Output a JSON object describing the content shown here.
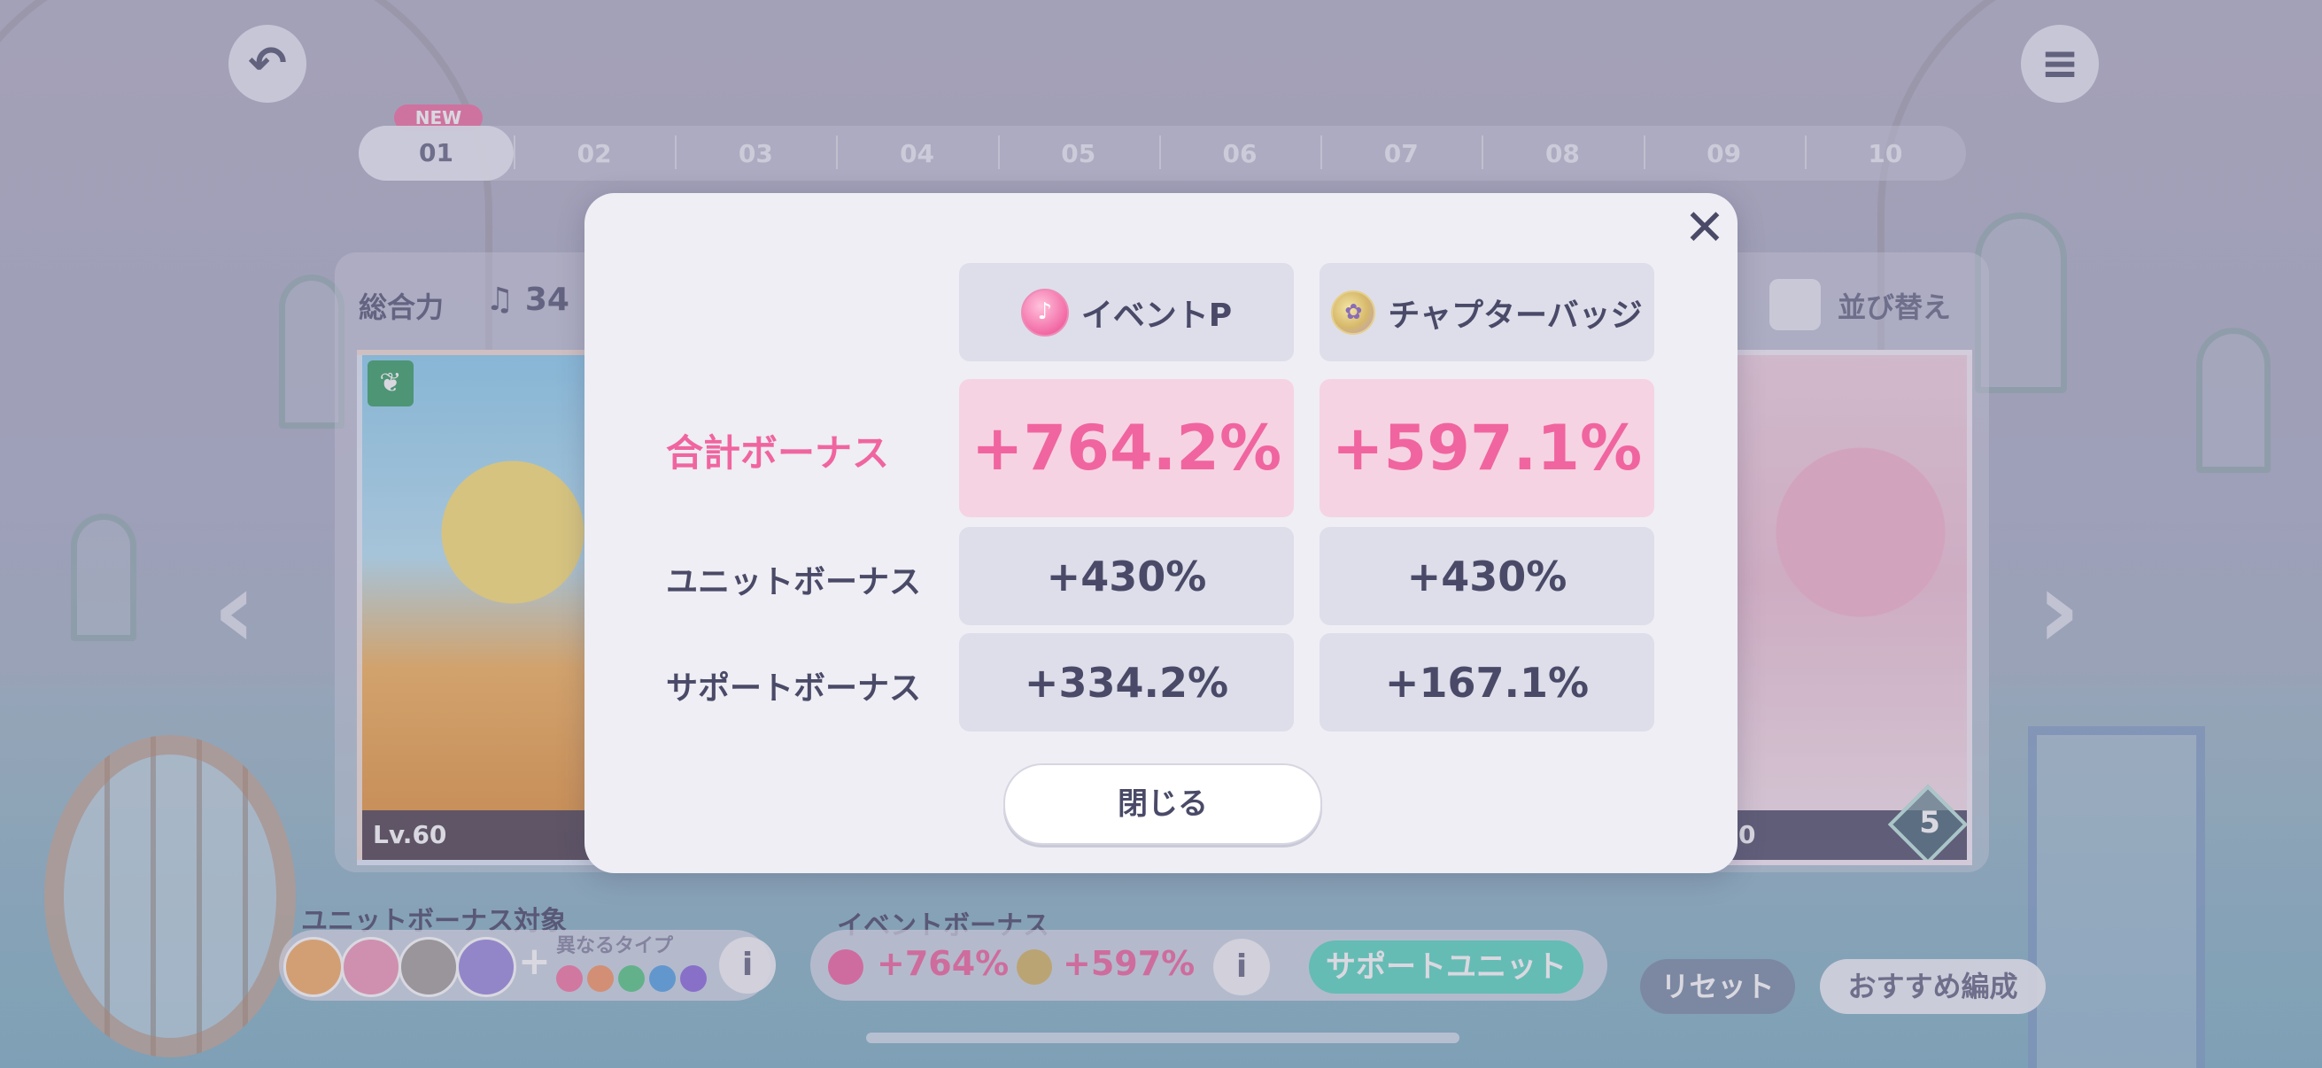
{
  "background": {
    "new_tag": "NEW",
    "chapters": [
      "01",
      "02",
      "03",
      "04",
      "05",
      "06",
      "07",
      "08",
      "09",
      "10"
    ],
    "deck_label": "総合力",
    "deck_power": "34",
    "sort_label": "並び替え",
    "card_left_level": "Lv.60",
    "card_right_level": "0",
    "card_right_rank": "5",
    "unit_bonus_label": "ユニットボーナス対象",
    "diff_type_label": "異なるタイプ",
    "event_bonus_label": "イベントボーナス",
    "event_bonus_ep": "+764%",
    "event_bonus_badge": "+597%",
    "support_unit_button": "サポートユニット",
    "reset_button": "リセット",
    "recommend_button": "おすすめ編成",
    "info_glyph": "i"
  },
  "modal": {
    "close_glyph": "✕",
    "columns": [
      {
        "label": "イベントP",
        "icon": "event-point-icon"
      },
      {
        "label": "チャプターバッジ",
        "icon": "chapter-badge-icon"
      }
    ],
    "rows": [
      {
        "label": "合計ボーナス",
        "values": [
          "+764.2%",
          "+597.1%"
        ]
      },
      {
        "label": "ユニットボーナス",
        "values": [
          "+430%",
          "+430%"
        ]
      },
      {
        "label": "サポートボーナス",
        "values": [
          "+334.2%",
          "+167.1%"
        ]
      }
    ],
    "close_button": "閉じる"
  },
  "colors": {
    "accent_pink": "#f0659f",
    "total_bg": "#f6d3e2",
    "cell_bg": "#dddeea",
    "text": "#4a4a68",
    "support_teal": "#5fd8c2"
  }
}
